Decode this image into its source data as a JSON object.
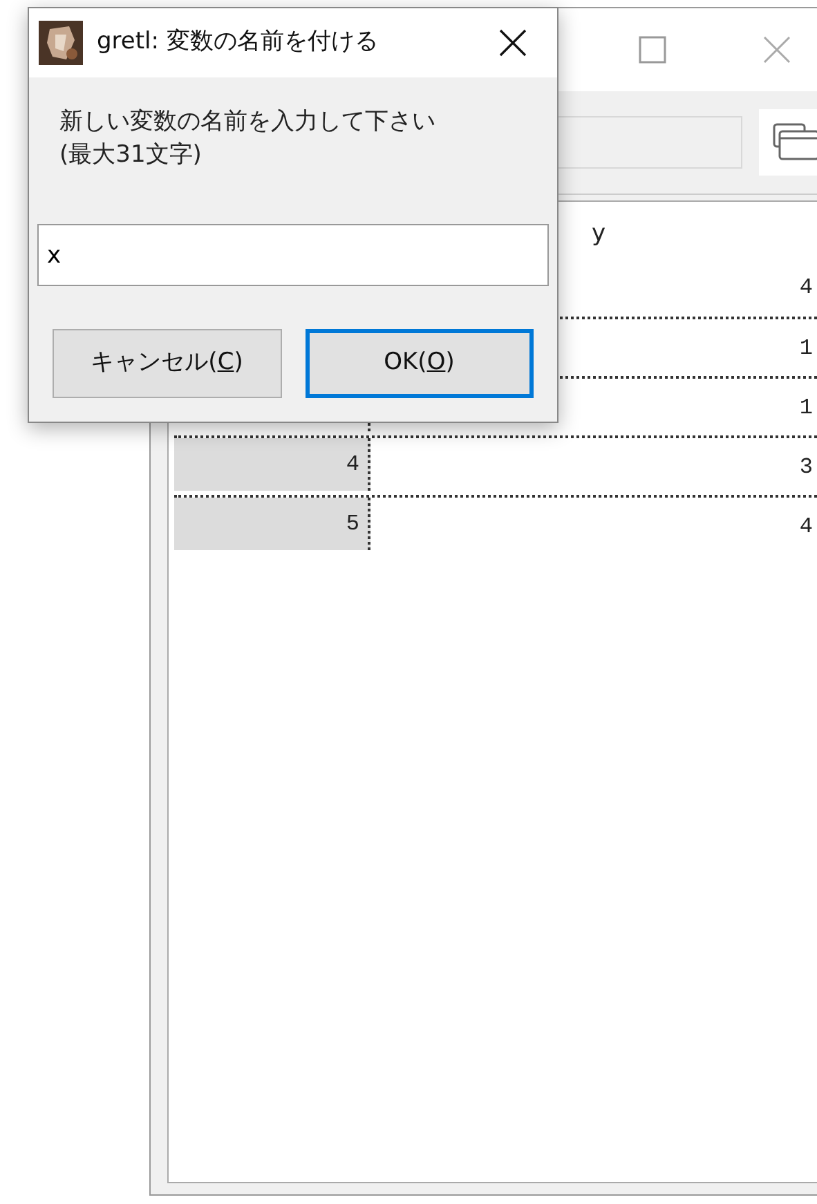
{
  "back_window": {
    "table": {
      "columns": [
        "y"
      ],
      "rows": [
        {
          "value": "4"
        },
        {
          "value": "1"
        },
        {
          "value": "1"
        },
        {
          "index": "4",
          "value": "3"
        },
        {
          "index": "5",
          "value": "4"
        }
      ]
    }
  },
  "dialog": {
    "title": "gretl: 変数の名前を付ける",
    "message": [
      "新しい変数の名前を入力して下さい",
      "(最大31文字)"
    ],
    "field": {
      "value": "x"
    },
    "buttons": [
      {
        "label_before": "キャンセル(",
        "access_key": "C",
        "label_after": ")",
        "default": false
      },
      {
        "label_before": "OK(",
        "access_key": "O",
        "label_after": ")",
        "default": true
      }
    ]
  }
}
